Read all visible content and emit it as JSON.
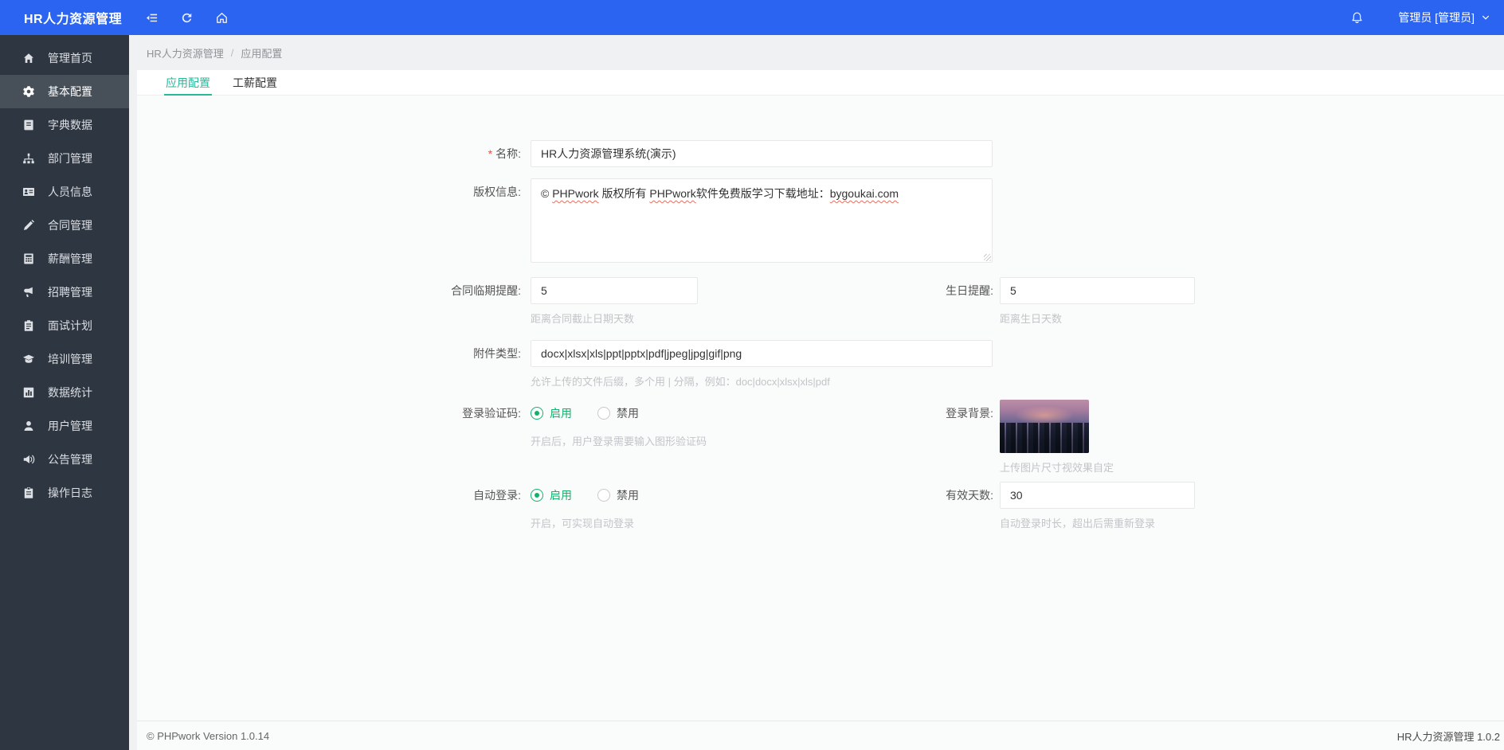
{
  "colors": {
    "header-blue": "#2b64f1",
    "side-bg": "#2e3642",
    "side-active-bg": "#474f59",
    "teal": "#27b99a",
    "green": "#13b26b",
    "red": "#e0534f"
  },
  "header": {
    "title": "HR人力资源管理",
    "user": "管理员 [管理员]"
  },
  "sidebar": {
    "items": [
      {
        "label": "管理首页"
      },
      {
        "label": "基本配置"
      },
      {
        "label": "字典数据"
      },
      {
        "label": "部门管理"
      },
      {
        "label": "人员信息"
      },
      {
        "label": "合同管理"
      },
      {
        "label": "薪酬管理"
      },
      {
        "label": "招聘管理"
      },
      {
        "label": "面试计划"
      },
      {
        "label": "培训管理"
      },
      {
        "label": "数据统计"
      },
      {
        "label": "用户管理"
      },
      {
        "label": "公告管理"
      },
      {
        "label": "操作日志"
      }
    ]
  },
  "breadcrumb": {
    "root": "HR人力资源管理",
    "separator": "/",
    "current": "应用配置"
  },
  "tabs": {
    "app": "应用配置",
    "salary": "工薪配置"
  },
  "form": {
    "name": {
      "label": "名称:",
      "required_mark": "*",
      "value": "HR人力资源管理系统(演示)"
    },
    "copyright": {
      "label": "版权信息:",
      "value": "© PHPwork 版权所有 PHPwork软件免费版学习下载地址：bygoukai.com",
      "segments": [
        "© ",
        "PHPwork",
        " 版权所有 ",
        "PHPwork",
        "软件免费版学习下载地址：",
        "bygoukai.com"
      ]
    },
    "contract_due": {
      "label": "合同临期提醒:",
      "value": "5",
      "help": "距离合同截止日期天数"
    },
    "birthday": {
      "label": "生日提醒:",
      "value": "5",
      "help": "距离生日天数"
    },
    "attach": {
      "label": "附件类型:",
      "value": "docx|xlsx|xls|ppt|pptx|pdf|jpeg|jpg|gif|png",
      "help": "允许上传的文件后缀，多个用 | 分隔，例如：doc|docx|xlsx|xls|pdf"
    },
    "captcha": {
      "label": "登录验证码:",
      "enabled": "启用",
      "disabled": "禁用",
      "selected": "启用",
      "help": "开启后，用户登录需要输入图形验证码"
    },
    "login_bg": {
      "label": "登录背景:",
      "help": "上传图片尺寸视效果自定"
    },
    "auto_login": {
      "label": "自动登录:",
      "enabled": "启用",
      "disabled": "禁用",
      "selected": "启用",
      "help": "开启，可实现自动登录"
    },
    "valid_days": {
      "label": "有效天数:",
      "value": "30",
      "help": "自动登录时长，超出后需重新登录"
    }
  },
  "footer": {
    "left": "© PHPwork Version 1.0.14",
    "right": "HR人力资源管理 1.0.2"
  }
}
